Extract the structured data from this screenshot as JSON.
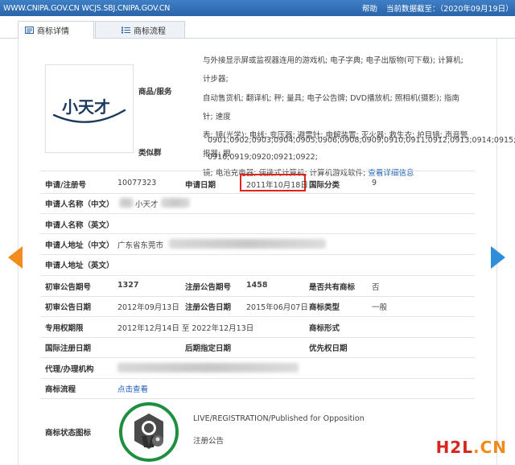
{
  "topbar": {
    "url": "WWW.CNIPA.GOV.CN WCJS.SBJ.CNIPA.GOV.CN",
    "help": "帮助",
    "data_date": "当前数据截至：（2020年09月19日）"
  },
  "tabs": [
    {
      "label": "商标详情",
      "icon": "document-icon",
      "active": true
    },
    {
      "label": "商标流程",
      "icon": "list-icon",
      "active": false
    }
  ],
  "logo_text": "小天才",
  "goods": {
    "label": "商品/服务",
    "lines": [
      "与外接显示屏或监视器连用的游戏机; 电子字典; 电子出版物(可下载); 计算机; 计步器;",
      "自动售货机; 翻译机; 秤; 量具; 电子公告牌; DVD播放机; 照相机(摄影); 指南针; 速度",
      "表; 镜(光学); 电线; 变压器; 避雷针; 电解装置; 灭火器; 救生衣; 护目镜; 声音警报器; 眼",
      "镜; 电池充电器; 便携式计算机; 计算机游戏软件; "
    ],
    "detail_link": "查看详细信息"
  },
  "similar_group": {
    "label": "类似群",
    "lines": [
      "0901;0902;0903;0904;0905;0906;0908;0909;0910;0911;0912;0913;0914;0915;",
      "0916;0919;0920;0921;0922;"
    ]
  },
  "fields": {
    "reg_no_label": "申请/注册号",
    "reg_no": "10077323",
    "apply_date_label": "申请日期",
    "apply_date": "2011年10月18日",
    "intl_class_label": "国际分类",
    "intl_class": "9",
    "applicant_cn_label": "申请人名称（中文）",
    "applicant_cn": "小天才",
    "applicant_en_label": "申请人名称（英文）",
    "address_cn_label": "申请人地址（中文）",
    "address_cn": "广东省东莞市",
    "address_en_label": "申请人地址（英文）",
    "prelim_no_label": "初审公告期号",
    "prelim_no": "1327",
    "reg_pub_no_label": "注册公告期号",
    "reg_pub_no": "1458",
    "shared_label": "是否共有商标",
    "shared": "否",
    "prelim_date_label": "初审公告日期",
    "prelim_date": "2012年09月13日",
    "reg_pub_date_label": "注册公告日期",
    "reg_pub_date": "2015年06月07日",
    "type_label": "商标类型",
    "type": "一般",
    "exclusive_label": "专用权期限",
    "exclusive": "2012年12月14日 至 2022年12月13日",
    "form_label": "商标形式",
    "intl_reg_date_label": "国际注册日期",
    "later_date_label": "后期指定日期",
    "priority_date_label": "优先权日期",
    "agent_label": "代理/办理机构",
    "process_label": "商标流程",
    "process_link": "点击查看",
    "status_label": "商标状态图标",
    "status_text": "LIVE/REGISTRATION/Published for Opposition",
    "status_cn": "注册公告"
  },
  "watermark": {
    "h2l": "H2L",
    "dot": ".",
    "cn": "CN"
  },
  "colors": {
    "topbar": "#2a63a8",
    "highlight_box": "#e2231a",
    "status_ring": "#1d8f3e",
    "link": "#1a5fb4",
    "arrow_left": "#f28c1e",
    "arrow_right": "#2f8ed8"
  }
}
